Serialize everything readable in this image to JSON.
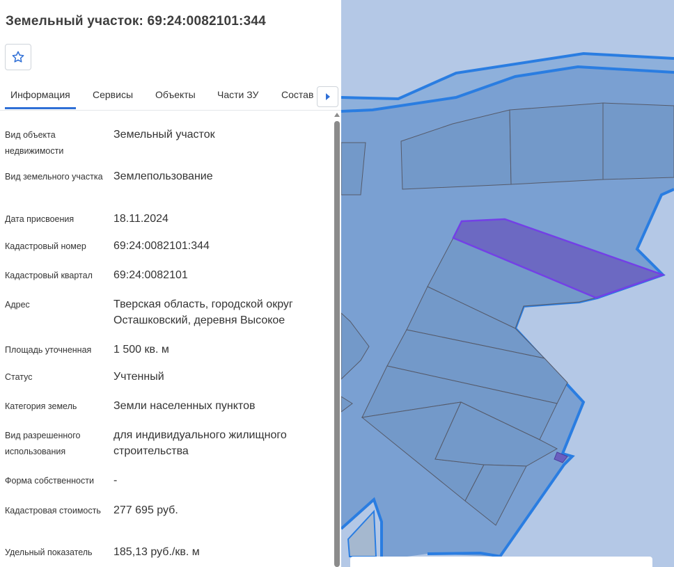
{
  "header": {
    "title": "Земельный участок: 69:24:0082101:344",
    "favorite_icon": "star-outline-icon"
  },
  "tabs": [
    {
      "label": "Информация",
      "active": true
    },
    {
      "label": "Сервисы",
      "active": false
    },
    {
      "label": "Объекты",
      "active": false
    },
    {
      "label": "Части ЗУ",
      "active": false
    },
    {
      "label": "Состав",
      "active": false
    }
  ],
  "tabs_next_icon": "arrow-right-icon",
  "info": [
    {
      "label": "Вид объекта недвижимости",
      "value": "Земельный участок"
    },
    {
      "label": "Вид земельного участка",
      "value": "Землепользование"
    },
    {
      "label": "Дата присвоения",
      "value": "18.11.2024"
    },
    {
      "label": "Кадастровый номер",
      "value": "69:24:0082101:344"
    },
    {
      "label": "Кадастровый квартал",
      "value": "69:24:0082101"
    },
    {
      "label": "Адрес",
      "value": "Тверская область, городской округ Осташковский, деревня Высокое"
    },
    {
      "label": "Площадь уточненная",
      "value": "1 500 кв. м"
    },
    {
      "label": "Статус",
      "value": "Учтенный"
    },
    {
      "label": "Категория земель",
      "value": "Земли населенных пунктов"
    },
    {
      "label": "Вид разрешенного использования",
      "value": "для индивидуального жилищного строительства"
    },
    {
      "label": "Форма собственности",
      "value": "-"
    },
    {
      "label": "Кадастровая стоимость",
      "value": "277 695 руб."
    },
    {
      "label": "Удельный показатель",
      "value": "185,13 руб./кв. м"
    }
  ],
  "colors": {
    "accent": "#2f6fd6",
    "map_background": "#b4c8e6",
    "parcel_fill": "#7aa0d2",
    "boundary": "#2a7de1",
    "selected_parcel": "#6a5fbf"
  }
}
